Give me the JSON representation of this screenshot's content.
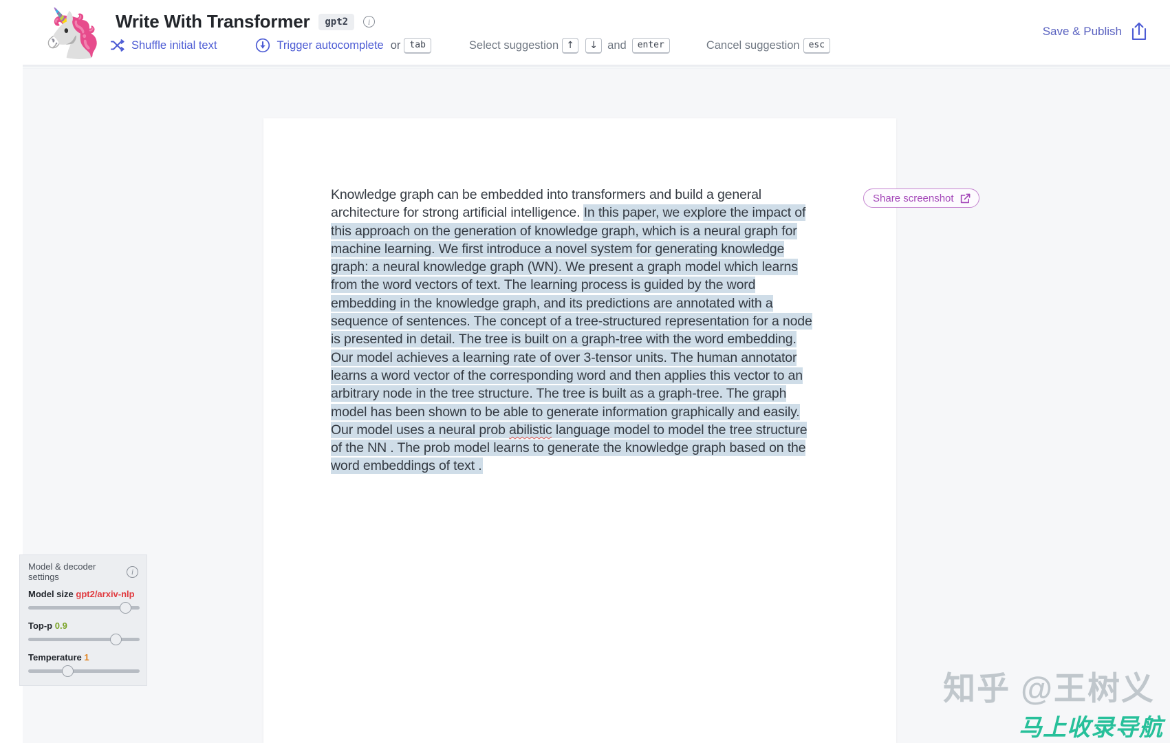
{
  "header": {
    "logo_emoji": "🦄",
    "title": "Write With Transformer",
    "model_badge": "gpt2",
    "info_glyph": "i",
    "shortcuts": {
      "shuffle_label": "Shuffle initial text",
      "autocomplete_label": "Trigger autocomplete",
      "or_label": "or",
      "tab_key": "tab",
      "select_label": "Select suggestion",
      "up_key": "↑",
      "down_key": "↓",
      "and_label": "and",
      "enter_key": "enter",
      "cancel_label": "Cancel suggestion",
      "esc_key": "esc"
    },
    "save_publish_label": "Save & Publish"
  },
  "share": {
    "label": "Share screenshot"
  },
  "document": {
    "seed_text": "Knowledge graph can be embedded into transformers and build a general architecture for strong artificial intelligence. ",
    "generated_text_a": "In this paper, we explore the impact of this approach on the generation of knowledge graph, which is a neural graph for machine learning. We first introduce a novel system for generating knowledge graph: a neural knowledge graph (WN).  We present a graph model which learns from the word vectors of text. The learning process is guided by the word embedding in the knowledge graph, and its predictions are annotated with  a sequence of sentences. The concept of a tree-structured representation for a node is presented in detail. The tree is built on a graph-tree with the word embedding. Our model achieves a learning rate of over 3-tensor units. The human annotator learns a word vector of the corresponding  word and then applies this vector to an arbitrary node in the tree structure. The tree is built as a graph-tree. The graph model has been shown to be able to generate information graphically and easily. Our model uses a neural prob ",
    "misspelled_word": "abilistic",
    "generated_text_b": " language model to model the tree structure of the NN . The prob model learns  to generate the knowledge graph based on the word embeddings of text ."
  },
  "settings": {
    "panel_title": "Model & decoder settings",
    "info_glyph": "i",
    "model_size_label": "Model size",
    "model_size_value": "gpt2/arxiv-nlp",
    "model_size_knob_pct": 92,
    "top_p_label": "Top-p",
    "top_p_value": "0.9",
    "top_p_knob_pct": 82,
    "temperature_label": "Temperature",
    "temperature_value": "1",
    "temperature_knob_pct": 34
  },
  "watermarks": {
    "zhihu": "知乎 @王树义",
    "green_banner": "马上收录导航"
  },
  "colors": {
    "accent_blue": "#4c5bd4",
    "highlight": "#cfdde8",
    "share_purple": "#a346b8",
    "model_red": "#e0393e",
    "topp_green": "#7ba428",
    "temp_orange": "#e0821e",
    "watermark_green": "#27c09a"
  }
}
